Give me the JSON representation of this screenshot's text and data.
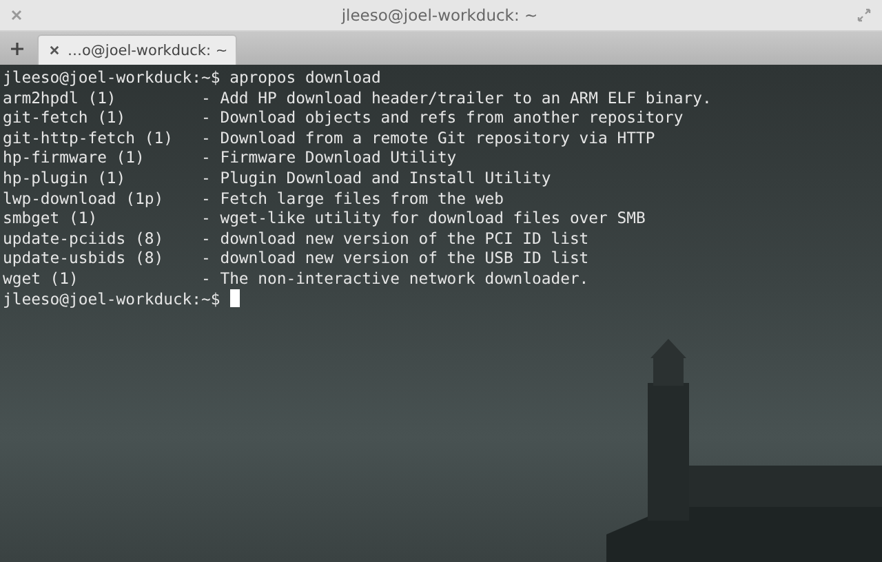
{
  "window": {
    "title": "jleeso@joel-workduck: ~"
  },
  "tabs": [
    {
      "label": "…o@joel-workduck: ~",
      "selected": true
    }
  ],
  "terminal": {
    "command_prompt": "jleeso@joel-workduck:~$",
    "command": "apropos download",
    "results": [
      {
        "name": "arm2hpdl (1)",
        "description": "- Add HP download header/trailer to an ARM ELF binary."
      },
      {
        "name": "git-fetch (1)",
        "description": "- Download objects and refs from another repository"
      },
      {
        "name": "git-http-fetch (1)",
        "description": "- Download from a remote Git repository via HTTP"
      },
      {
        "name": "hp-firmware (1)",
        "description": "- Firmware Download Utility"
      },
      {
        "name": "hp-plugin (1)",
        "description": "- Plugin Download and Install Utility"
      },
      {
        "name": "lwp-download (1p)",
        "description": "- Fetch large files from the web"
      },
      {
        "name": "smbget (1)",
        "description": "- wget-like utility for download files over SMB"
      },
      {
        "name": "update-pciids (8)",
        "description": "- download new version of the PCI ID list"
      },
      {
        "name": "update-usbids (8)",
        "description": "- download new version of the USB ID list"
      },
      {
        "name": "wget (1)",
        "description": "- The non-interactive network downloader."
      }
    ],
    "final_prompt": "jleeso@joel-workduck:~$"
  }
}
